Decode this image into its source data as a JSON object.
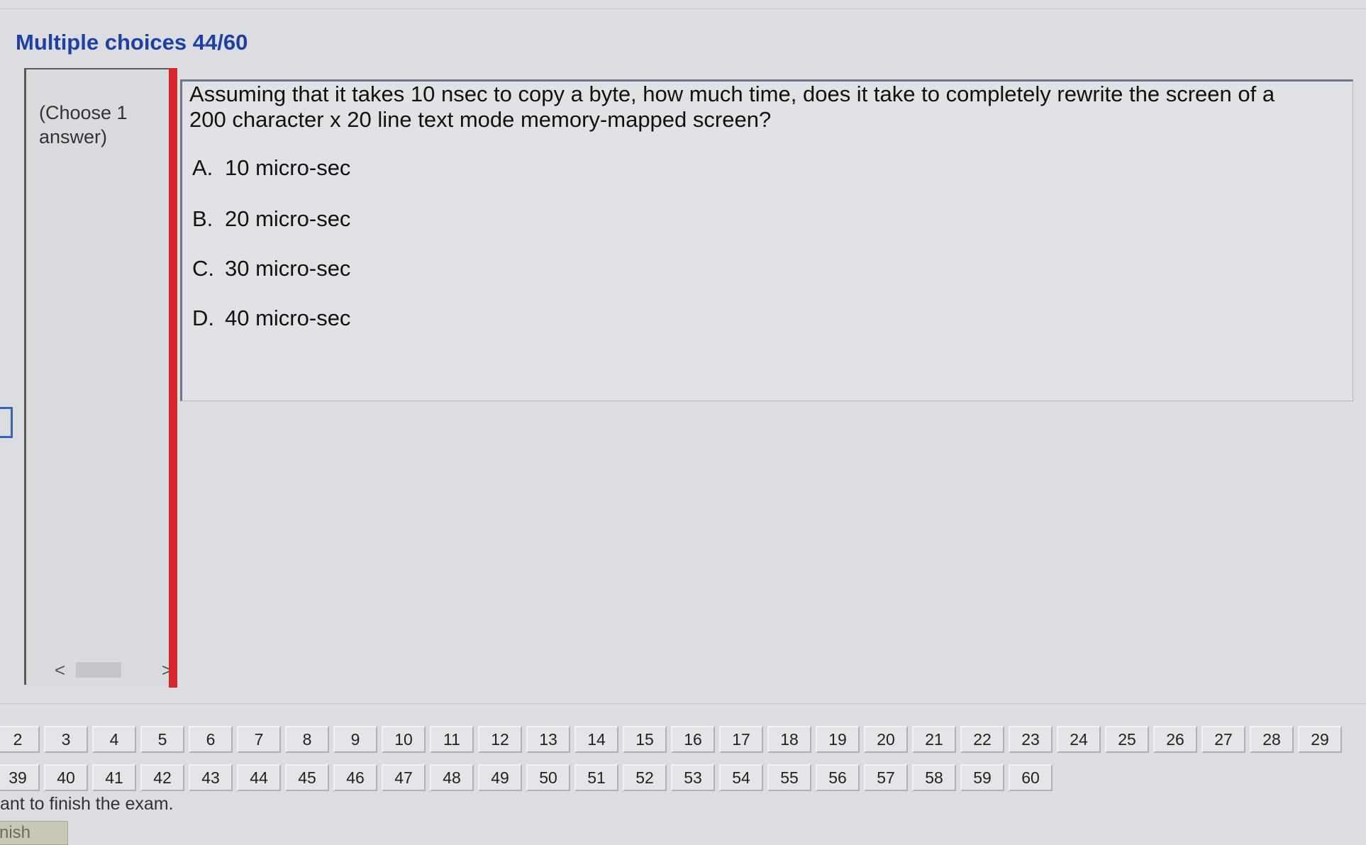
{
  "header": {
    "title": "Multiple choices 44/60"
  },
  "sidebar": {
    "hint": "(Choose 1 answer)",
    "scroll_left": "<",
    "scroll_right": ">"
  },
  "question": {
    "text": "Assuming that it takes 10 nsec to copy a byte, how much time, does it take to completely rewrite the screen of a 200 character x 20 line text mode memory-mapped screen?",
    "options": [
      {
        "letter": "A.",
        "text": "10 micro-sec"
      },
      {
        "letter": "B.",
        "text": "20 micro-sec"
      },
      {
        "letter": "C.",
        "text": "30 micro-sec"
      },
      {
        "letter": "D.",
        "text": "40 micro-sec"
      }
    ]
  },
  "navigation": {
    "row1": [
      "2",
      "3",
      "4",
      "5",
      "6",
      "7",
      "8",
      "9",
      "10",
      "11",
      "12",
      "13",
      "14",
      "15",
      "16",
      "17",
      "18",
      "19",
      "20",
      "21",
      "22",
      "23",
      "24",
      "25",
      "26",
      "27",
      "28",
      "29"
    ],
    "row2": [
      "39",
      "40",
      "41",
      "42",
      "43",
      "44",
      "45",
      "46",
      "47",
      "48",
      "49",
      "50",
      "51",
      "52",
      "53",
      "54",
      "55",
      "56",
      "57",
      "58",
      "59",
      "60"
    ]
  },
  "footer": {
    "message": "ant to finish the exam.",
    "finish_label": "nish"
  }
}
